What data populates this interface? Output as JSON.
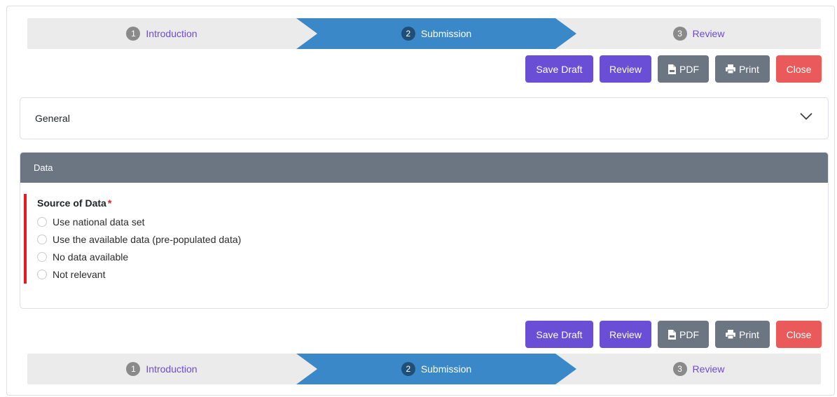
{
  "steps": [
    {
      "num": "1",
      "label": "Introduction"
    },
    {
      "num": "2",
      "label": "Submission"
    },
    {
      "num": "3",
      "label": "Review"
    }
  ],
  "actions": {
    "save_draft": "Save Draft",
    "review": "Review",
    "pdf": "PDF",
    "print": "Print",
    "close": "Close"
  },
  "general": {
    "title": "General",
    "icon": "chevron-down-icon"
  },
  "data_panel": {
    "title": "Data",
    "field": {
      "label": "Source of Data",
      "required_mark": "*",
      "options": [
        "Use national data set",
        "Use the available data (pre-populated data)",
        "No data available",
        "Not relevant"
      ]
    }
  },
  "colors": {
    "active_step": "#3a88c8",
    "primary_button": "#6a4fd6",
    "secondary_button": "#6c7682",
    "danger_button": "#ea5a5a",
    "required_bar": "#e81c1c"
  }
}
